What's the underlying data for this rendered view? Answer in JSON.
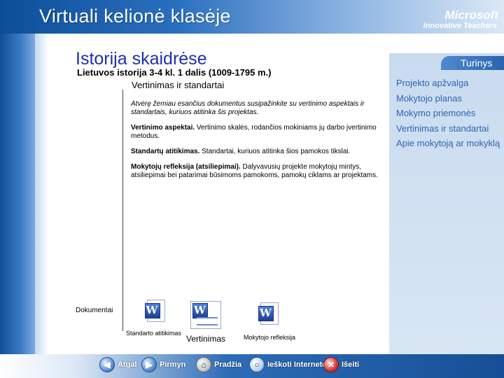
{
  "banner": {
    "title": "Virtuali kelionė klasėje",
    "brand": "Microsoft",
    "brand_sub": "Innovative Teachers"
  },
  "main": {
    "title": "Istorija skaidrėse",
    "subtitle": "Lietuvos istorija 3-4 kl. 1 dalis (1009-1795 m.)",
    "section_title": "Vertinimas ir standartai",
    "intro": "Atvėrę žemiau esančius dokumentus susipažinkite su vertinimo aspektais ir standartais, kuriuos atitinka šis projektas.",
    "paragraphs": [
      {
        "label": "Vertinimo aspektai.",
        "text": " Vertinimo skalės, rodančios mokiniams jų darbo įvertinimo metodus."
      },
      {
        "label": "Standartų atitikimas.",
        "text": "  Standartai, kuriuos atitinka šios pamokos tikslai."
      },
      {
        "label": "Mokytojų refleksija (atsiliepimai).",
        "text": " Dalyvavusių projekte mokytojų mintys, atsiliepimai bei patarimai būsimoms pamokoms, pamokų ciklams ar projektams."
      }
    ],
    "documents_label": "Dokumentai",
    "documents": [
      {
        "caption": "Standarto atitikimas",
        "icon": "word-doc-icon"
      },
      {
        "caption": "Vertinimas",
        "icon": "word-doc-icon"
      },
      {
        "caption": "Mokytojo refleksija",
        "icon": "word-doc-icon"
      }
    ]
  },
  "sidebar": {
    "tab_label": "Turinys",
    "items": [
      {
        "label": "Projekto apžvalga"
      },
      {
        "label": "Mokytojo planas"
      },
      {
        "label": "Mokymo priemonės"
      },
      {
        "label": "Vertinimas ir standartai"
      },
      {
        "label": "Apie mokytoją ar mokyklą"
      }
    ]
  },
  "footer": {
    "buttons": [
      {
        "label": "Atgal",
        "icon": "arrow-left-icon"
      },
      {
        "label": "Pirmyn",
        "icon": "arrow-right-icon"
      },
      {
        "label": "Pradžia",
        "icon": "home-icon"
      },
      {
        "label": "Ieškoti Internete",
        "icon": "magnifier-icon"
      },
      {
        "label": "Išeiti",
        "icon": "close-icon"
      }
    ]
  },
  "colors": {
    "accent": "#1d2fb0",
    "sidebar_link": "#2d64b5",
    "banner_dark": "#0d4e98"
  }
}
